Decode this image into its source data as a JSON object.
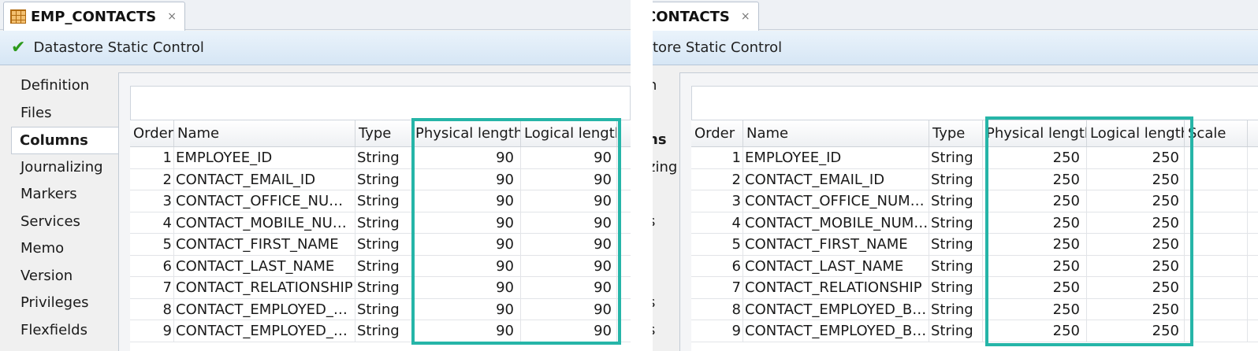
{
  "highlight_color": "#26b5a8",
  "left": {
    "tab": {
      "title": "EMP_CONTACTS",
      "close": "×",
      "icon": "datastore-icon"
    },
    "toolbar": {
      "icon": "check-icon",
      "label": "Datastore Static Control"
    },
    "nav": [
      "Definition",
      "Files",
      "Columns",
      "Journalizing",
      "Markers",
      "Services",
      "Memo",
      "Version",
      "Privileges",
      "Flexfields"
    ],
    "nav_active": "Columns",
    "columns": {
      "order": "Order",
      "name": "Name",
      "type": "Type",
      "phys": "Physical length",
      "log": "Logical length"
    },
    "rows": [
      {
        "order": "1",
        "name": "EMPLOYEE_ID",
        "type": "String",
        "phys": "90",
        "log": "90"
      },
      {
        "order": "2",
        "name": "CONTACT_EMAIL_ID",
        "type": "String",
        "phys": "90",
        "log": "90"
      },
      {
        "order": "3",
        "name": "CONTACT_OFFICE_NU…",
        "type": "String",
        "phys": "90",
        "log": "90"
      },
      {
        "order": "4",
        "name": "CONTACT_MOBILE_NU…",
        "type": "String",
        "phys": "90",
        "log": "90"
      },
      {
        "order": "5",
        "name": "CONTACT_FIRST_NAME",
        "type": "String",
        "phys": "90",
        "log": "90"
      },
      {
        "order": "6",
        "name": "CONTACT_LAST_NAME",
        "type": "String",
        "phys": "90",
        "log": "90"
      },
      {
        "order": "7",
        "name": "CONTACT_RELATIONSHIP",
        "type": "String",
        "phys": "90",
        "log": "90"
      },
      {
        "order": "8",
        "name": "CONTACT_EMPLOYED_B…",
        "type": "String",
        "phys": "90",
        "log": "90"
      },
      {
        "order": "9",
        "name": "CONTACT_EMPLOYED_B…",
        "type": "String",
        "phys": "90",
        "log": "90"
      }
    ]
  },
  "right": {
    "tab": {
      "title": "CONTACTS",
      "close": "×"
    },
    "toolbar": {
      "label": "tore Static Control"
    },
    "nav": [
      "n",
      "",
      "ns",
      "zing",
      "",
      "s",
      "",
      "",
      "s",
      "s"
    ],
    "columns": {
      "order": "Order",
      "name": "Name",
      "type": "Type",
      "phys": "Physical length",
      "log": "Logical length",
      "scale": "Scale"
    },
    "rows": [
      {
        "order": "1",
        "name": "EMPLOYEE_ID",
        "type": "String",
        "phys": "250",
        "log": "250"
      },
      {
        "order": "2",
        "name": "CONTACT_EMAIL_ID",
        "type": "String",
        "phys": "250",
        "log": "250"
      },
      {
        "order": "3",
        "name": "CONTACT_OFFICE_NUM…",
        "type": "String",
        "phys": "250",
        "log": "250"
      },
      {
        "order": "4",
        "name": "CONTACT_MOBILE_NUM…",
        "type": "String",
        "phys": "250",
        "log": "250"
      },
      {
        "order": "5",
        "name": "CONTACT_FIRST_NAME",
        "type": "String",
        "phys": "250",
        "log": "250"
      },
      {
        "order": "6",
        "name": "CONTACT_LAST_NAME",
        "type": "String",
        "phys": "250",
        "log": "250"
      },
      {
        "order": "7",
        "name": "CONTACT_RELATIONSHIP",
        "type": "String",
        "phys": "250",
        "log": "250"
      },
      {
        "order": "8",
        "name": "CONTACT_EMPLOYED_B…",
        "type": "String",
        "phys": "250",
        "log": "250"
      },
      {
        "order": "9",
        "name": "CONTACT_EMPLOYED_B…",
        "type": "String",
        "phys": "250",
        "log": "250"
      }
    ]
  }
}
